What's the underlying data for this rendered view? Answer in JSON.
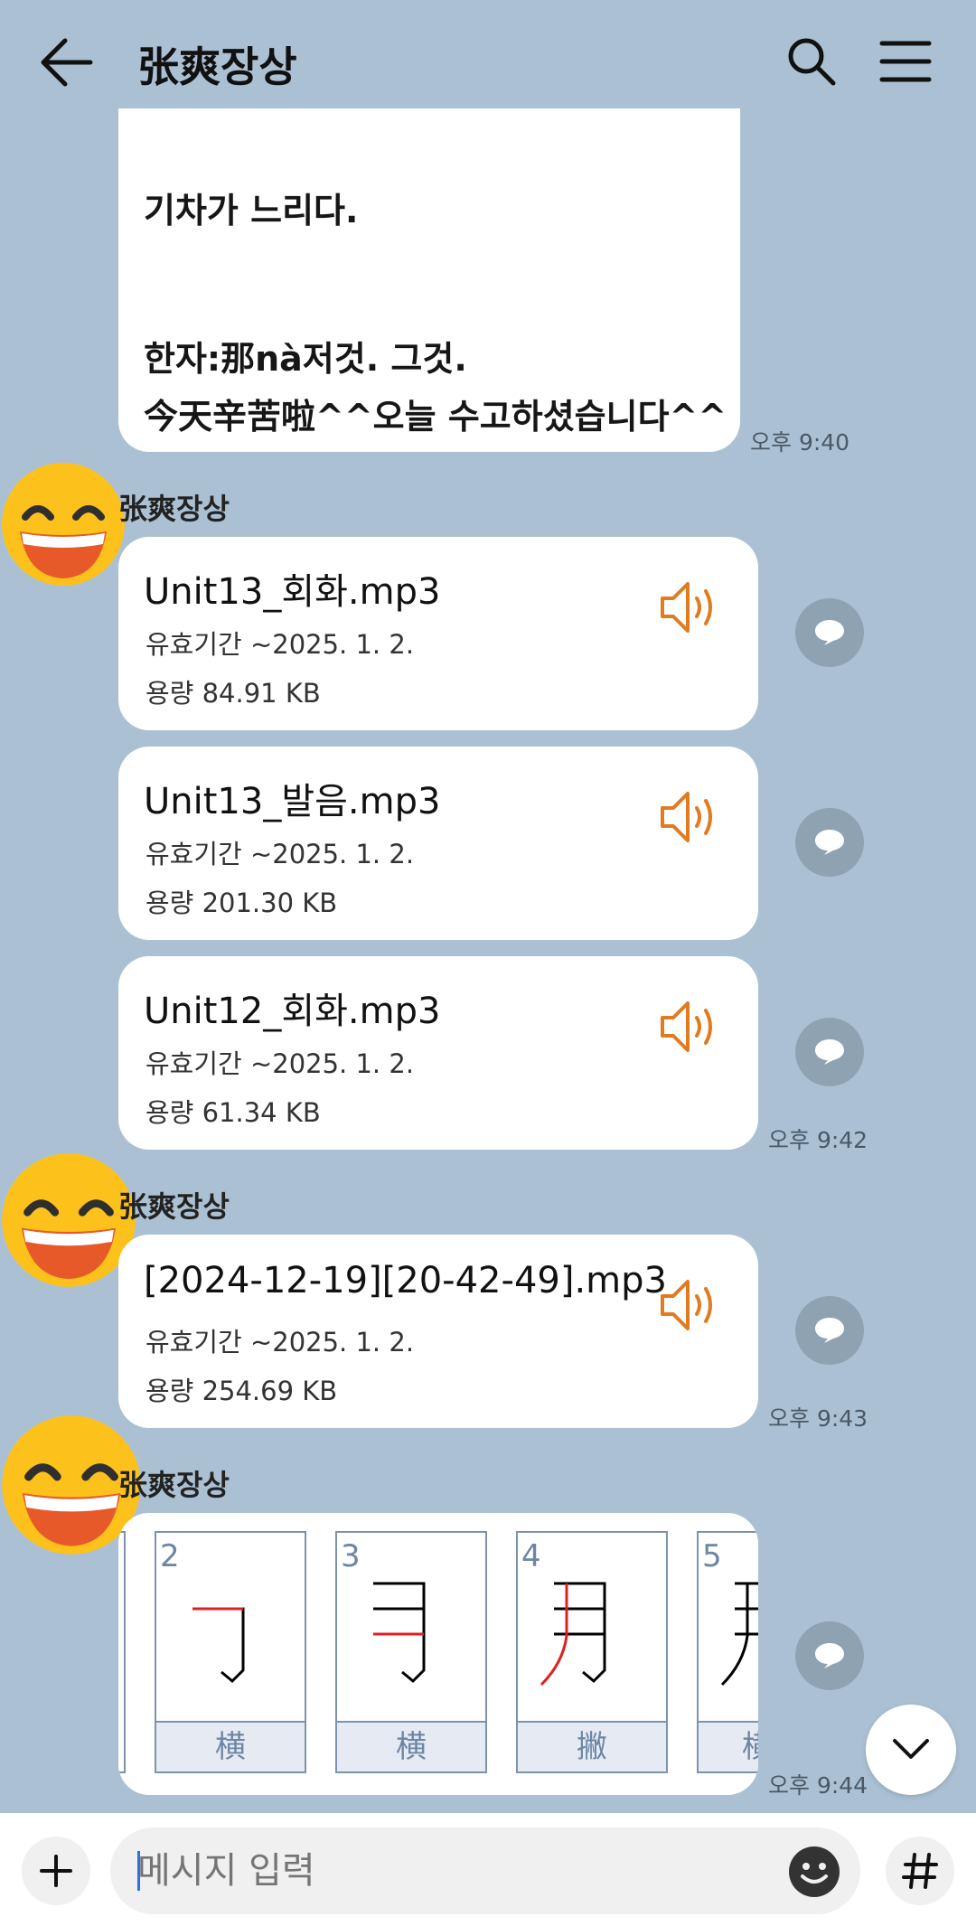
{
  "header": {
    "title": "张爽장상"
  },
  "text_message": {
    "lines": [
      "기차가 느리다.",
      "한자:那nà저것. 그것.",
      "今天辛苦啦^^오늘 수고하셨습니다^^"
    ],
    "time": "오후 9:40"
  },
  "group1": {
    "sender": "张爽장상",
    "time": "오후 9:42",
    "files": [
      {
        "name": "Unit13_회화.mp3",
        "expiry": "유효기간 ~2025. 1. 2.",
        "size": "용량  84.91 KB"
      },
      {
        "name": "Unit13_발음.mp3",
        "expiry": "유효기간 ~2025. 1. 2.",
        "size": "용량  201.30 KB"
      },
      {
        "name": "Unit12_회화.mp3",
        "expiry": "유효기간 ~2025. 1. 2.",
        "size": "용량  61.34 KB"
      }
    ]
  },
  "group2": {
    "sender": "张爽장상",
    "time": "오후 9:43",
    "file": {
      "name": "[2024-12-19][20-42-49].mp3",
      "expiry": "유효기간 ~2025. 1. 2.",
      "size": "용량  254.69 KB"
    }
  },
  "group3": {
    "sender": "张爽장상",
    "time": "오후 9:44",
    "stroke_cards": [
      {
        "num": "2",
        "label": "横"
      },
      {
        "num": "3",
        "label": "横"
      },
      {
        "num": "4",
        "label": "撇"
      },
      {
        "num": "5",
        "label": "横折"
      }
    ]
  },
  "input": {
    "placeholder": "메시지 입력"
  },
  "colors": {
    "background": "#abc1d3",
    "speaker_icon": "#e07b1f",
    "comment_icon": "#8fa2b2"
  },
  "icons": [
    "back-arrow-icon",
    "search-icon",
    "menu-icon",
    "speaker-icon",
    "comment-icon",
    "chevron-down-icon",
    "plus-icon",
    "emoji-icon",
    "hash-icon",
    "laughing-face-icon"
  ]
}
